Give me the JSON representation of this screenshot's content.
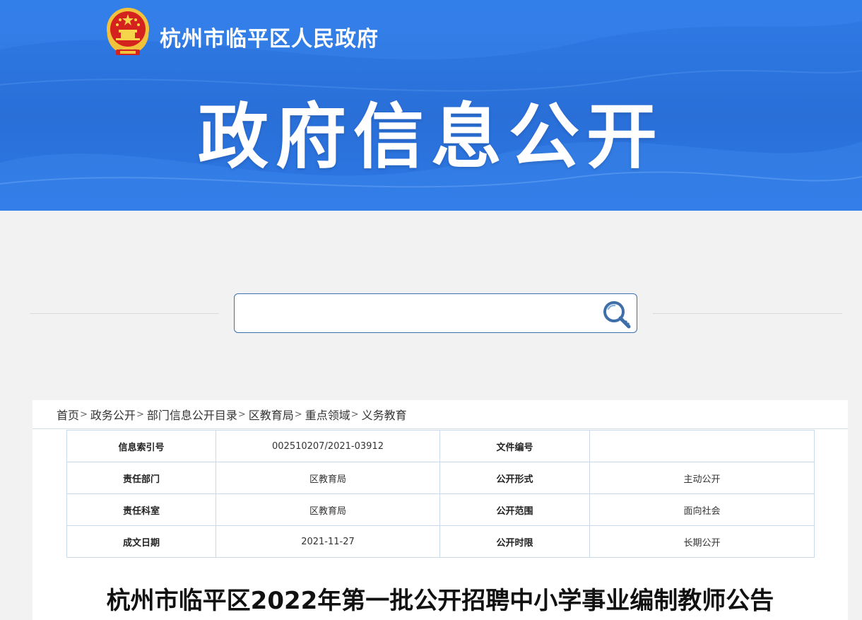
{
  "header": {
    "site_name": "杭州市临平区人民政府",
    "banner_title": "政府信息公开",
    "brand_color": "#2a6fd8"
  },
  "search": {
    "value": "",
    "placeholder": ""
  },
  "breadcrumb": [
    {
      "label": "首页"
    },
    {
      "label": "政务公开"
    },
    {
      "label": "部门信息公开目录"
    },
    {
      "label": "区教育局"
    },
    {
      "label": "重点领域"
    },
    {
      "label": "义务教育"
    }
  ],
  "breadcrumb_sep": ">",
  "meta_table": {
    "rows": [
      {
        "label1": "信息索引号",
        "value1": "002510207/2021-03912",
        "label2": "文件编号",
        "value2": ""
      },
      {
        "label1": "责任部门",
        "value1": "区教育局",
        "label2": "公开形式",
        "value2": "主动公开"
      },
      {
        "label1": "责任科室",
        "value1": "区教育局",
        "label2": "公开范围",
        "value2": "面向社会"
      },
      {
        "label1": "成文日期",
        "value1": "2021-11-27",
        "label2": "公开时限",
        "value2": "长期公开"
      }
    ]
  },
  "article": {
    "title": "杭州市临平区2022年第一批公开招聘中小学事业编制教师公告"
  }
}
